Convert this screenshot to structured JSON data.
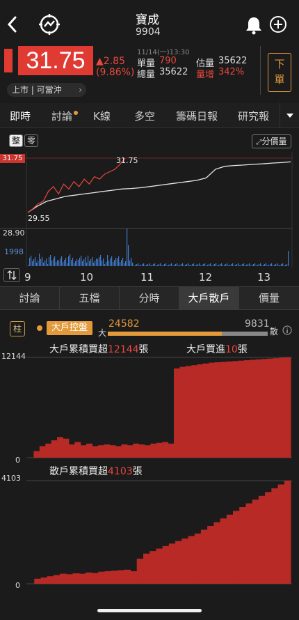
{
  "header": {
    "stock_name": "寶成",
    "stock_code": "9904",
    "back_icon": "chevron-left-icon",
    "trend_icon": "trend-circle-icon",
    "bell_icon": "bell-icon",
    "add_icon": "plus-circle-icon"
  },
  "quote": {
    "price": "31.75",
    "change": "▲2.85",
    "change_pct": "(9.86%)",
    "datetime": "11/14(一)13:30",
    "unit_vol_label": "單量",
    "unit_vol": "790",
    "est_vol_label": "估量",
    "est_vol": "35622",
    "total_vol_label": "總量",
    "total_vol": "35622",
    "vol_increase_label": "量增",
    "vol_increase": "342%",
    "order_button": "下\n單",
    "listing_badge": "上市 | 可當沖",
    "colors": {
      "up": "#e8483d",
      "price_bg": "#e03b33",
      "order_border": "#e39a3b"
    }
  },
  "tabs": [
    "即時",
    "討論",
    "K線",
    "多空",
    "籌碼日報",
    "研究報"
  ],
  "tab_dropdown_icon": "triangle-down-icon",
  "chart_controls": {
    "whole_label": "整",
    "odd_label": "零",
    "price_vol_label": "分價量",
    "swap_icon": "swap-vertical-icon"
  },
  "intraday_chart": {
    "top_price_label": "31.75",
    "high_label": "31.75",
    "low_label": "29.55",
    "ref_price_label": "28.90",
    "vol_max_label": "1998",
    "x_ticks": [
      "9",
      "10",
      "11",
      "12",
      "13"
    ]
  },
  "subtabs": [
    "討論",
    "五檔",
    "分時",
    "大戶散戶",
    "價量"
  ],
  "big_small": {
    "column_chip": "柱",
    "toggle_label": "大戶控盤",
    "big_label": "大",
    "big_value": "24582",
    "small_value": "9831",
    "small_label": "散",
    "info_icon": "info-circle-icon",
    "big_cum_label": "大戶累積買超",
    "big_cum_value": "12144",
    "unit": "張",
    "big_buy_label": "大戶買進",
    "big_buy_value": "10",
    "small_cum_label": "散戶累積買超",
    "small_cum_value": "4103"
  },
  "chart_data": [
    {
      "type": "line",
      "title": "",
      "x_ticks": [
        "9",
        "10",
        "11",
        "12",
        "13"
      ],
      "ylim": [
        28.9,
        31.75
      ],
      "series": [
        {
          "values": [
            29.55,
            29.7,
            29.9,
            30.0,
            30.4,
            30.6,
            30.3,
            30.7,
            30.5,
            30.8,
            30.6,
            30.9,
            30.7,
            31.0,
            30.9,
            31.1,
            31.2,
            31.3,
            31.5,
            31.75
          ]
        },
        {
          "values": [
            29.55,
            29.8,
            30.0,
            30.1,
            30.2,
            30.25,
            30.3,
            30.35,
            30.4,
            30.45,
            30.5,
            30.52,
            30.55,
            30.6,
            30.65,
            30.7,
            30.75,
            30.8,
            30.85,
            30.95,
            31.3,
            31.42,
            31.45,
            31.47,
            31.5,
            31.52,
            31.55,
            31.57,
            31.6
          ]
        }
      ]
    },
    {
      "type": "area",
      "title": "大戶累積買超",
      "ylim": [
        0,
        12144
      ],
      "tick_labels": [
        "12144",
        "0"
      ],
      "values": [
        0,
        800,
        1400,
        1700,
        2100,
        2500,
        2300,
        1600,
        1900,
        1500,
        1700,
        1400,
        1500,
        1600,
        1500,
        1400,
        1600,
        1500,
        1700,
        1600,
        1500,
        1700,
        1800,
        1900,
        1700,
        10800,
        11000,
        11100,
        11200,
        11300,
        11400,
        11500,
        11550,
        11600,
        11650,
        11700,
        11750,
        11800,
        11850,
        11900,
        11950,
        12000,
        12050,
        12100,
        12144
      ]
    },
    {
      "type": "area",
      "title": "散戶累積買超",
      "ylim": [
        0,
        4103
      ],
      "tick_labels": [
        "4103",
        "0"
      ],
      "values": [
        0,
        200,
        250,
        300,
        350,
        400,
        380,
        420,
        400,
        450,
        430,
        480,
        500,
        520,
        540,
        560,
        500,
        1000,
        1200,
        1300,
        1400,
        1500,
        1600,
        1700,
        1800,
        1900,
        2000,
        2150,
        2300,
        2450,
        2600,
        2750,
        2900,
        3050,
        3200,
        3350,
        3500,
        3650,
        3800,
        3950,
        4103
      ]
    }
  ]
}
